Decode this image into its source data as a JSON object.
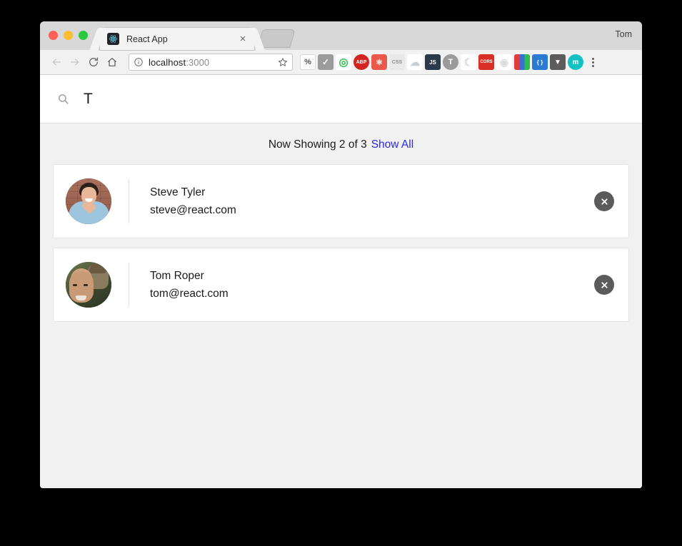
{
  "window": {
    "profile_name": "Tom",
    "traffic_lights": [
      "close",
      "minimize",
      "maximize"
    ]
  },
  "tab": {
    "title": "React App",
    "favicon": "react-logo-icon",
    "close_label": "×"
  },
  "toolbar": {
    "back_icon": "back-arrow-icon",
    "forward_icon": "forward-arrow-icon",
    "reload_icon": "reload-icon",
    "home_icon": "home-icon",
    "info_icon": "page-info-icon",
    "url_host": "localhost",
    "url_port": ":3000",
    "star_icon": "bookmark-star-icon",
    "menu_icon": "chrome-menu-icon",
    "extensions": [
      {
        "name": "percent-extension",
        "label": "%",
        "bg": "#ffffff",
        "fg": "#555555"
      },
      {
        "name": "checkmark-extension",
        "label": "✓",
        "bg": "#9b9b9b",
        "fg": "#ffffff"
      },
      {
        "name": "ghostery-extension",
        "label": "",
        "bg": "#ffffff",
        "fg": "#2cbe4e"
      },
      {
        "name": "adblock-plus-extension",
        "label": "ABP",
        "bg": "#d22421",
        "fg": "#ffffff"
      },
      {
        "name": "react-devtools-extension",
        "label": "",
        "bg": "#e8594a",
        "fg": "#ffffff"
      },
      {
        "name": "css-viewer-extension",
        "label": "CSS",
        "bg": "#e9e9e9",
        "fg": "#8d8d8d"
      },
      {
        "name": "cloud-extension",
        "label": "",
        "bg": "#ffffff",
        "fg": "#c6cdd4"
      },
      {
        "name": "javascript-toggle-extension",
        "label": "JS",
        "bg": "#2b3a4a",
        "fg": "#ffffff"
      },
      {
        "name": "tampermonkey-extension",
        "label": "T",
        "bg": "#9b9b9b",
        "fg": "#ffffff"
      },
      {
        "name": "moon-extension",
        "label": "",
        "bg": "#ffffff",
        "fg": "#d4d4d4"
      },
      {
        "name": "cors-extension",
        "label": "CORS",
        "bg": "#d93025",
        "fg": "#ffffff"
      },
      {
        "name": "target-extension",
        "label": "",
        "bg": "#ffffff",
        "fg": "#dcdcdc"
      },
      {
        "name": "colorzilla-extension",
        "label": "",
        "bg": "#3b6fd4",
        "fg": "#ffffff"
      },
      {
        "name": "json-viewer-extension",
        "label": "{ }",
        "bg": "#2b7bd4",
        "fg": "#ffffff"
      },
      {
        "name": "pocket-extension",
        "label": "",
        "bg": "#5c5c5c",
        "fg": "#ffffff"
      },
      {
        "name": "momentum-extension",
        "label": "m",
        "bg": "#12c2c2",
        "fg": "#ffffff"
      }
    ]
  },
  "page": {
    "search": {
      "icon": "search-icon",
      "value": "T",
      "placeholder": ""
    },
    "results": {
      "prefix": "Now Showing 2 of 3",
      "showing_count": 2,
      "total_count": 3,
      "show_all_label": "Show All"
    },
    "contacts": [
      {
        "name": "Steve Tyler",
        "email": "steve@react.com",
        "avatar": "avatar-steve",
        "delete_icon": "close-circle-icon"
      },
      {
        "name": "Tom Roper",
        "email": "tom@react.com",
        "avatar": "avatar-tom",
        "delete_icon": "close-circle-icon"
      }
    ]
  },
  "colors": {
    "link": "#2a2aee",
    "page_bg": "#f1f1f1",
    "card_bg": "#ffffff",
    "delete_btn": "#5b5b5b"
  }
}
